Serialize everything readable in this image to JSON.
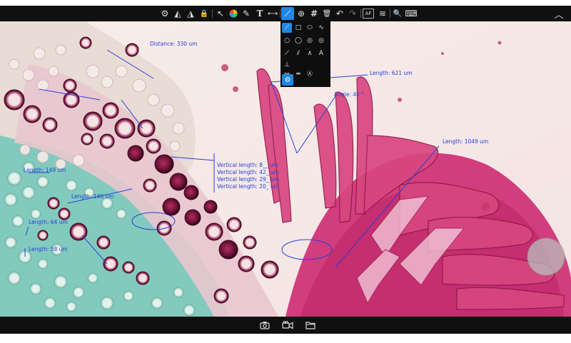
{
  "toolbar": {
    "tools": [
      {
        "name": "settings-icon",
        "glyph": "⚙"
      },
      {
        "name": "flip-horizontal-icon",
        "glyph": "◭"
      },
      {
        "name": "flip-vertical-icon",
        "glyph": "◮"
      },
      {
        "name": "lock-icon",
        "glyph": "🔒"
      },
      {
        "name": "pointer-icon",
        "glyph": "↖"
      },
      {
        "name": "color-wheel-icon",
        "glyph": "●"
      },
      {
        "name": "pen-icon",
        "glyph": "✎"
      },
      {
        "name": "text-tool-icon",
        "glyph": "T"
      },
      {
        "name": "ruler-icon",
        "glyph": "⟷"
      },
      {
        "name": "line-measure-icon",
        "glyph": "⟋"
      },
      {
        "name": "crosshair-icon",
        "glyph": "⊕"
      },
      {
        "name": "grid-icon",
        "glyph": "#"
      },
      {
        "name": "trash-icon",
        "glyph": "🗑"
      },
      {
        "name": "undo-icon",
        "glyph": "↶"
      },
      {
        "name": "redo-icon",
        "glyph": "↷"
      },
      {
        "name": "autofocus-icon",
        "glyph": "AF"
      },
      {
        "name": "layers-icon",
        "glyph": "≋"
      },
      {
        "name": "zoom-icon",
        "glyph": "🔍"
      },
      {
        "name": "keyboard-icon",
        "glyph": "⌨"
      }
    ],
    "collapse_glyph": "︿"
  },
  "palette": {
    "items": [
      "⟋",
      "□",
      "⬭",
      "∿",
      "○",
      "◯",
      "◎",
      "◎",
      "⟋",
      "⫽",
      "∧",
      "A",
      "⊥",
      "",
      "",
      "",
      "⚯",
      "⚮",
      "",
      "Ⓐ"
    ],
    "settings_glyph": "⚙"
  },
  "bottombar": {
    "camera_glyph": "📷",
    "video_glyph": "🎥",
    "folder_glyph": "🗀"
  },
  "measurements": [
    "Distance: 330 um",
    "Length: 621 um",
    "Angle: 46 °",
    "Length: 1049 um",
    "Length: 148 um",
    "Length: 146 um",
    "Length: 64 um",
    "Length: 58 um",
    "Vertical length: 8__ um",
    "Vertical length: 42_ um",
    "Vertical length: 29_ um",
    "Vertical length: 20_ um"
  ],
  "colors": {
    "annotation": "#2740d8",
    "accent": "#1e88e5",
    "toolbar_bg": "#101010"
  }
}
